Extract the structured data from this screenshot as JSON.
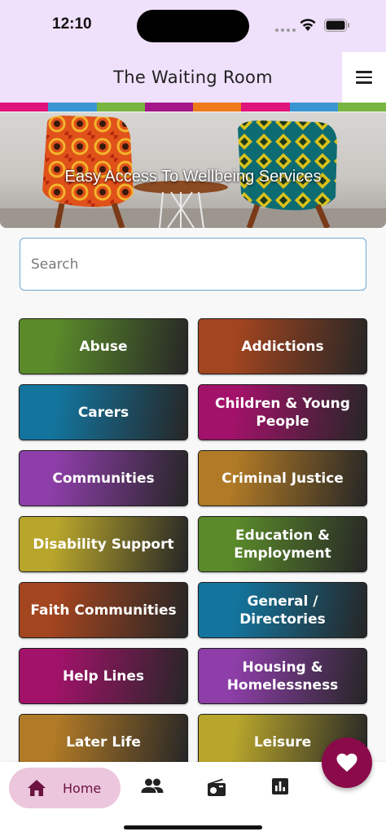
{
  "status_bar": {
    "time": "12:10"
  },
  "header": {
    "title": "The Waiting Room"
  },
  "stripe_colors": [
    "#e0137a",
    "#3b95d3",
    "#78b641",
    "#a4178a",
    "#ee7a1a",
    "#e0137a",
    "#3b95d3",
    "#78b641"
  ],
  "banner": {
    "tagline": "Easy Access To Wellbeing Services"
  },
  "search": {
    "placeholder": "Search",
    "value": ""
  },
  "categories": [
    {
      "label": "Abuse",
      "color": "#5a8a2a"
    },
    {
      "label": "Addictions",
      "color": "#a3451f"
    },
    {
      "label": "Carers",
      "color": "#13759e"
    },
    {
      "label": "Children & Young People",
      "color": "#a3126a"
    },
    {
      "label": "Communities",
      "color": "#8d3ea8"
    },
    {
      "label": "Criminal Justice",
      "color": "#b07a26"
    },
    {
      "label": "Disability Support",
      "color": "#b8a62c"
    },
    {
      "label": "Education & Employment",
      "color": "#5a8a2a"
    },
    {
      "label": "Faith Communities",
      "color": "#a3451f"
    },
    {
      "label": "General / Directories",
      "color": "#13759e"
    },
    {
      "label": "Help Lines",
      "color": "#a3126a"
    },
    {
      "label": "Housing & Homelessness",
      "color": "#8d3ea8"
    },
    {
      "label": "Later Life",
      "color": "#b07a26"
    },
    {
      "label": "Leisure",
      "color": "#b8a62c"
    }
  ],
  "bottom_nav": {
    "home_label": "Home",
    "items": [
      "home-icon",
      "people-icon",
      "radio-icon",
      "bar-chart-icon"
    ]
  },
  "fab": {
    "icon": "heart-icon",
    "color": "#8a0a4a"
  }
}
